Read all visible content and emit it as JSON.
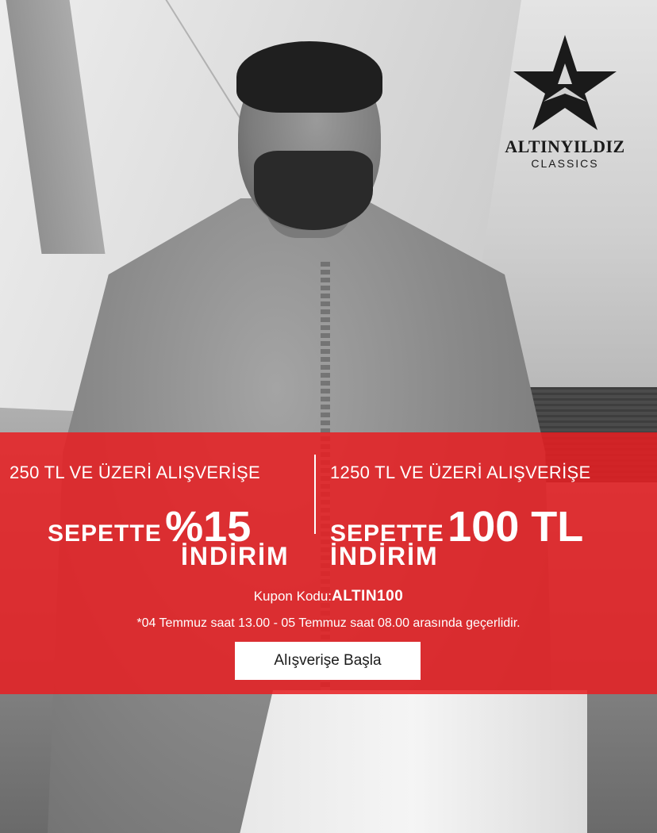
{
  "brand": {
    "name": "ALTINYILDIZ",
    "sub": "CLASSICS",
    "logo_icon": "star-logo-icon"
  },
  "promo": {
    "left": {
      "condition": "250 TL VE ÜZERİ ALIŞVERİŞE",
      "prefix": "SEPETTE",
      "amount": "%15",
      "suffix": "İNDİRİM"
    },
    "right": {
      "condition": "1250 TL VE ÜZERİ ALIŞVERİŞE",
      "prefix": "SEPETTE",
      "amount": "100 TL",
      "suffix": "İNDİRİM"
    },
    "coupon_label": "Kupon Kodu:",
    "coupon_code": "ALTIN100",
    "validity": "*04 Temmuz saat 13.00 - 05 Temmuz saat 08.00 arasında geçerlidir.",
    "cta_label": "Alışverişe Başla"
  },
  "colors": {
    "band": "#E81E22",
    "text": "#FFFFFF",
    "cta_bg": "#FFFFFF",
    "logo": "#1A1A1A"
  }
}
